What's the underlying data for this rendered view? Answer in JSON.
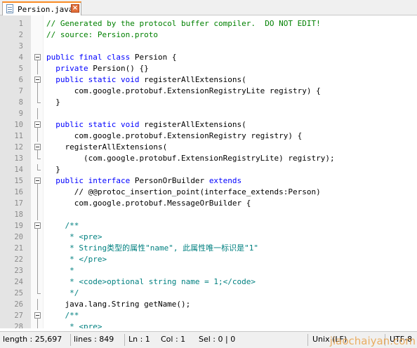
{
  "tab": {
    "label": "Persion.java",
    "close_glyph": "×",
    "icon": "java-file-icon"
  },
  "code": {
    "lines": [
      {
        "num": "1",
        "fold": "none",
        "segments": [
          {
            "cls": "c-comment",
            "text": "// Generated by the protocol buffer compiler.  DO NOT EDIT!"
          }
        ]
      },
      {
        "num": "2",
        "fold": "none",
        "segments": [
          {
            "cls": "c-comment",
            "text": "// source: Persion.proto"
          }
        ]
      },
      {
        "num": "3",
        "fold": "none",
        "segments": []
      },
      {
        "num": "4",
        "fold": "box",
        "segments": [
          {
            "cls": "c-kw",
            "text": "public final class "
          },
          {
            "cls": "c-plain",
            "text": "Persion {"
          }
        ]
      },
      {
        "num": "5",
        "fold": "line",
        "segments": [
          {
            "cls": "c-kw",
            "text": "  private "
          },
          {
            "cls": "c-plain",
            "text": "Persion() {}"
          }
        ]
      },
      {
        "num": "6",
        "fold": "box",
        "segments": [
          {
            "cls": "c-kw",
            "text": "  public static void "
          },
          {
            "cls": "c-plain",
            "text": "registerAllExtensions("
          }
        ]
      },
      {
        "num": "7",
        "fold": "line",
        "segments": [
          {
            "cls": "c-plain",
            "text": "      com.google.protobuf.ExtensionRegistryLite registry) {"
          }
        ]
      },
      {
        "num": "8",
        "fold": "end",
        "segments": [
          {
            "cls": "c-plain",
            "text": "  }"
          }
        ]
      },
      {
        "num": "9",
        "fold": "line",
        "segments": []
      },
      {
        "num": "10",
        "fold": "box",
        "segments": [
          {
            "cls": "c-kw",
            "text": "  public static void "
          },
          {
            "cls": "c-plain",
            "text": "registerAllExtensions("
          }
        ]
      },
      {
        "num": "11",
        "fold": "line",
        "segments": [
          {
            "cls": "c-plain",
            "text": "      com.google.protobuf.ExtensionRegistry registry) {"
          }
        ]
      },
      {
        "num": "12",
        "fold": "box",
        "segments": [
          {
            "cls": "c-plain",
            "text": "    registerAllExtensions("
          }
        ]
      },
      {
        "num": "13",
        "fold": "end",
        "segments": [
          {
            "cls": "c-plain",
            "text": "        (com.google.protobuf.ExtensionRegistryLite) registry);"
          }
        ]
      },
      {
        "num": "14",
        "fold": "end",
        "segments": [
          {
            "cls": "c-plain",
            "text": "  }"
          }
        ]
      },
      {
        "num": "15",
        "fold": "box",
        "segments": [
          {
            "cls": "c-kw",
            "text": "  public interface "
          },
          {
            "cls": "c-plain",
            "text": "PersonOrBuilder "
          },
          {
            "cls": "c-kw",
            "text": "extends"
          }
        ]
      },
      {
        "num": "16",
        "fold": "line",
        "segments": [
          {
            "cls": "c-plain",
            "text": "      // @@protoc_insertion_point(interface_extends:Person)"
          }
        ]
      },
      {
        "num": "17",
        "fold": "line",
        "segments": [
          {
            "cls": "c-plain",
            "text": "      com.google.protobuf.MessageOrBuilder {"
          }
        ]
      },
      {
        "num": "18",
        "fold": "line",
        "segments": []
      },
      {
        "num": "19",
        "fold": "box",
        "segments": [
          {
            "cls": "c-doc",
            "text": "    /**"
          }
        ]
      },
      {
        "num": "20",
        "fold": "line",
        "segments": [
          {
            "cls": "c-doc",
            "text": "     * <pre>"
          }
        ]
      },
      {
        "num": "21",
        "fold": "line",
        "segments": [
          {
            "cls": "c-doc",
            "text": "     * String类型的属性\"name\", 此属性唯一标识是\"1\""
          }
        ]
      },
      {
        "num": "22",
        "fold": "line",
        "segments": [
          {
            "cls": "c-doc",
            "text": "     * </pre>"
          }
        ]
      },
      {
        "num": "23",
        "fold": "line",
        "segments": [
          {
            "cls": "c-doc",
            "text": "     *"
          }
        ]
      },
      {
        "num": "24",
        "fold": "line",
        "segments": [
          {
            "cls": "c-doc",
            "text": "     * <code>optional string name = 1;</code>"
          }
        ]
      },
      {
        "num": "25",
        "fold": "end",
        "segments": [
          {
            "cls": "c-doc",
            "text": "     */"
          }
        ]
      },
      {
        "num": "26",
        "fold": "line",
        "segments": [
          {
            "cls": "c-plain",
            "text": "    java.lang.String getName();"
          }
        ]
      },
      {
        "num": "27",
        "fold": "box",
        "segments": [
          {
            "cls": "c-doc",
            "text": "    /**"
          }
        ]
      },
      {
        "num": "28",
        "fold": "line",
        "segments": [
          {
            "cls": "c-doc",
            "text": "     * <pre>"
          }
        ]
      }
    ]
  },
  "status": {
    "length": "length : 25,697",
    "lines": "lines : 849",
    "ln": "Ln : 1",
    "col": "Col : 1",
    "sel": "Sel : 0 | 0",
    "eol": "Unix (LF)",
    "encoding": "UTF-8"
  },
  "watermark": "jiaochaiyan.com",
  "colors": {
    "comment": "#008000",
    "keyword": "#0000ff",
    "doc": "#008080",
    "tab_accent": "#fa8c24"
  }
}
